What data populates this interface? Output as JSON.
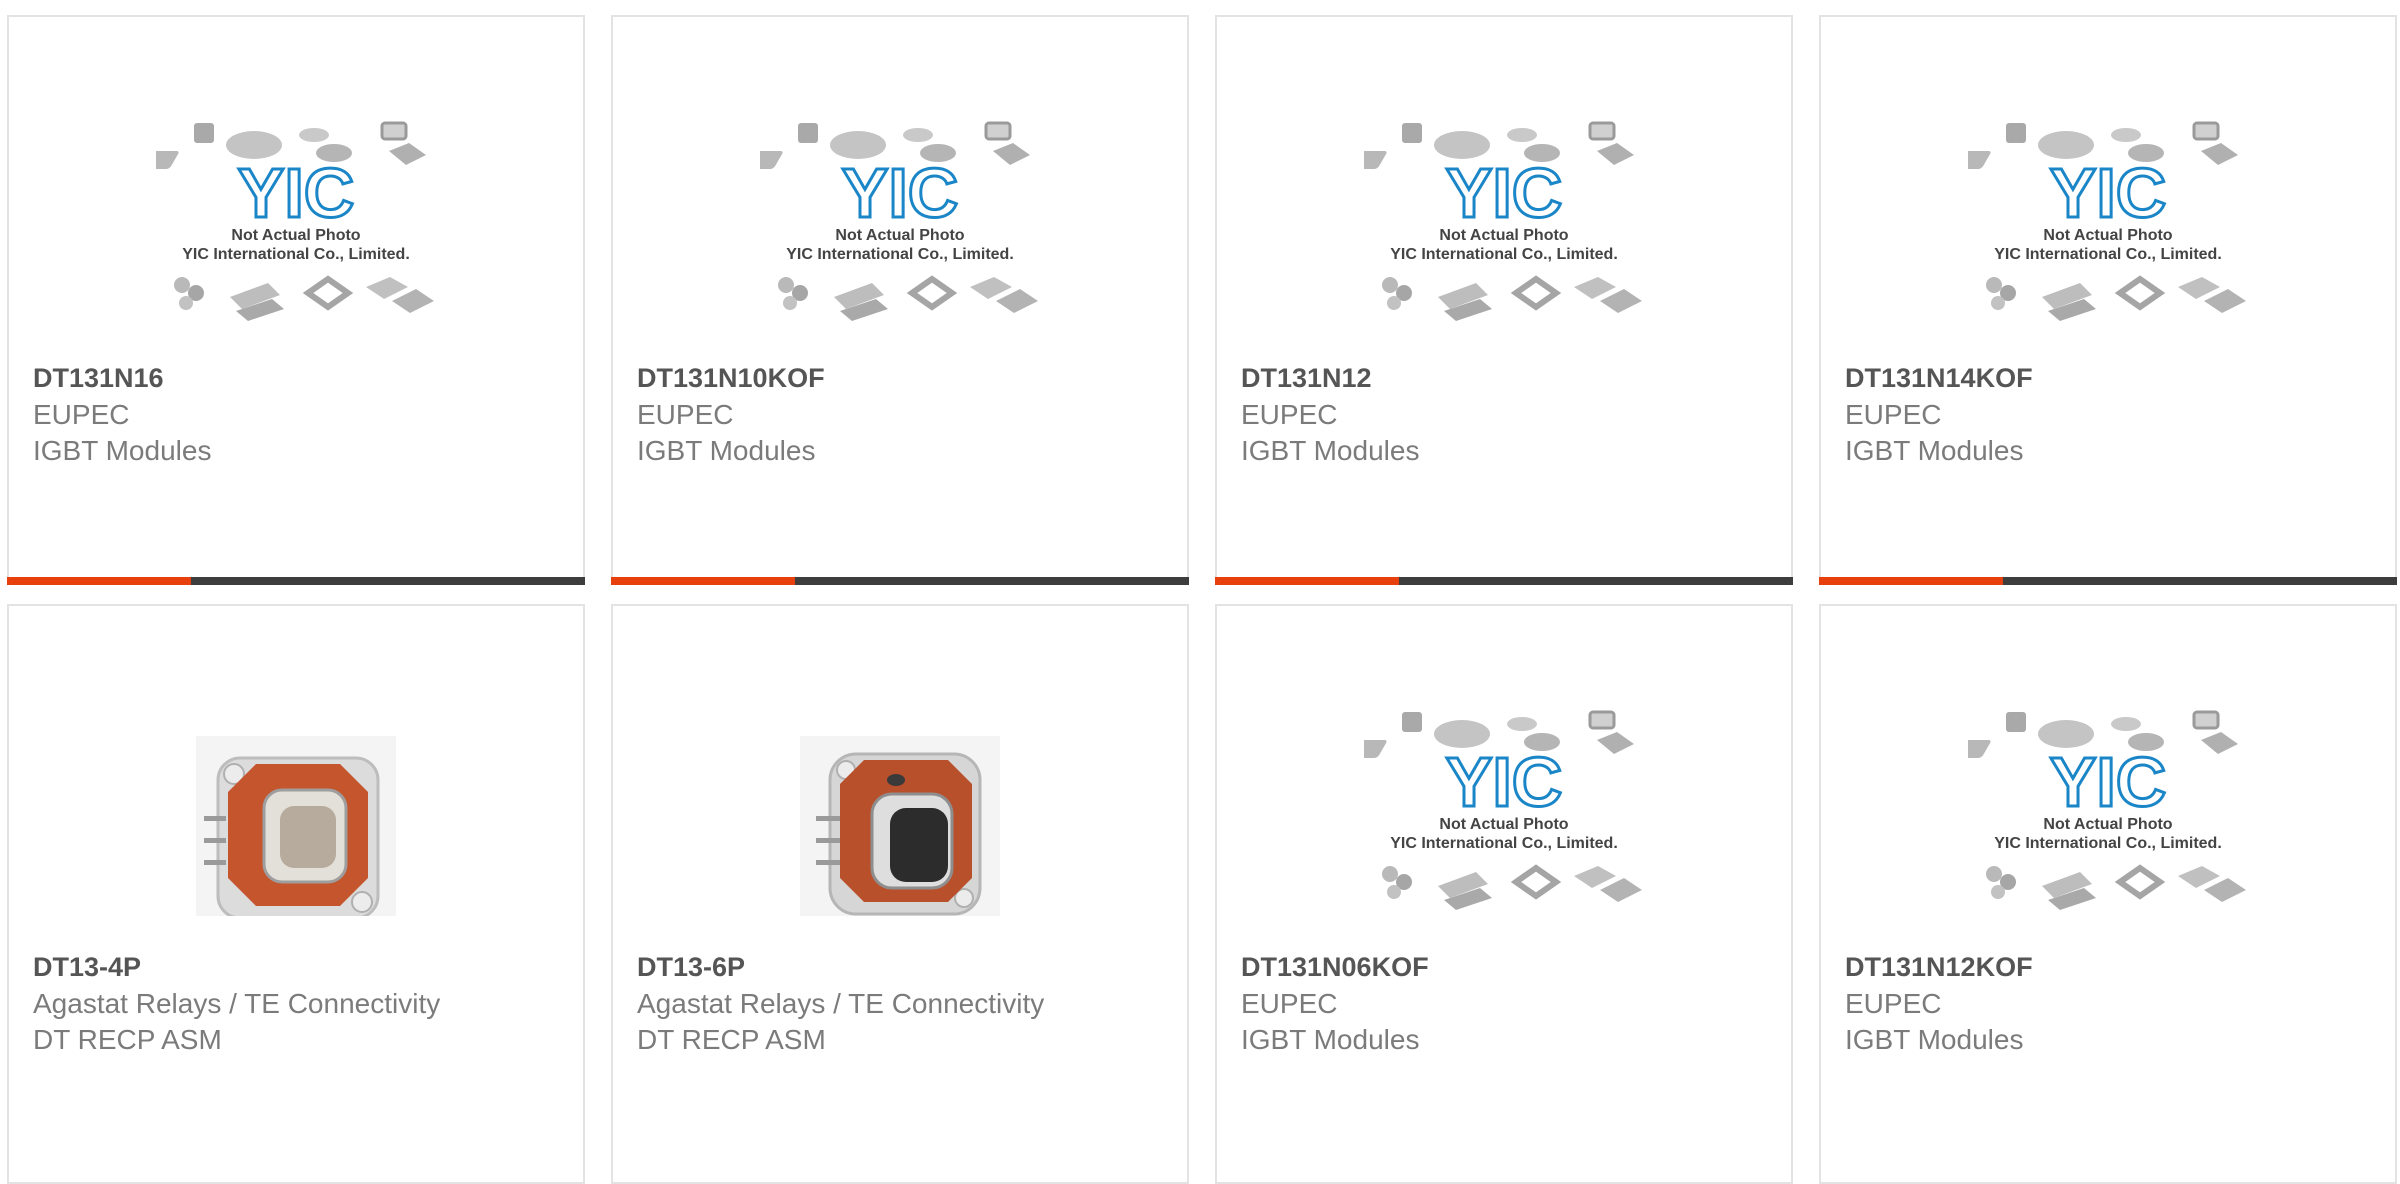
{
  "colors": {
    "accent": "#e8400c",
    "bar": "#3d3d3d",
    "logo": "#1a86c8"
  },
  "placeholder": {
    "logo_text": "YIC",
    "line1": "Not Actual Photo",
    "line2": "YIC International Co., Limited."
  },
  "products": [
    {
      "part": "DT131N16",
      "manufacturer": "EUPEC",
      "category": "IGBT Modules",
      "image": "placeholder-icon"
    },
    {
      "part": "DT131N10KOF",
      "manufacturer": "EUPEC",
      "category": "IGBT Modules",
      "image": "placeholder-icon"
    },
    {
      "part": "DT131N12",
      "manufacturer": "EUPEC",
      "category": "IGBT Modules",
      "image": "placeholder-icon"
    },
    {
      "part": "DT131N14KOF",
      "manufacturer": "EUPEC",
      "category": "IGBT Modules",
      "image": "placeholder-icon"
    },
    {
      "part": "DT13-4P",
      "manufacturer": "Agastat Relays / TE Connectivity",
      "category": "DT RECP ASM",
      "image": "connector-photo-gray"
    },
    {
      "part": "DT13-6P",
      "manufacturer": "Agastat Relays / TE Connectivity",
      "category": "DT RECP ASM",
      "image": "connector-photo-black"
    },
    {
      "part": "DT131N06KOF",
      "manufacturer": "EUPEC",
      "category": "IGBT Modules",
      "image": "placeholder-icon"
    },
    {
      "part": "DT131N12KOF",
      "manufacturer": "EUPEC",
      "category": "IGBT Modules",
      "image": "placeholder-icon"
    }
  ]
}
